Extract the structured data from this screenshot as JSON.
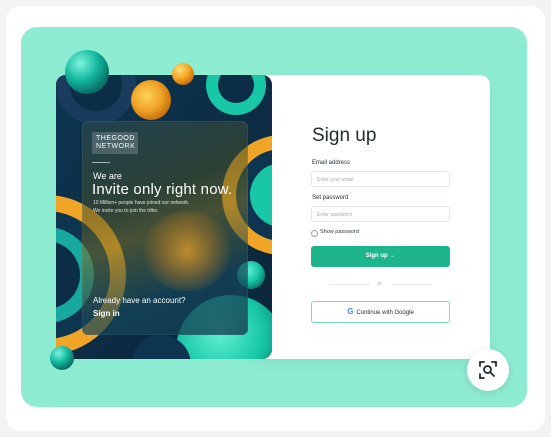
{
  "brand": {
    "line1": "THEGOOD",
    "line2": "NETWORK"
  },
  "promo": {
    "kicker": "We are",
    "headline": "Invite only right now.",
    "line1": "10 Million+ people have joined our network.",
    "line2": "We invite you to join the tribe.",
    "account_prompt": "Already have an account?",
    "signin_link": "Sign in"
  },
  "form": {
    "title": "Sign up",
    "email_label": "Email address",
    "email_placeholder": "Enter your email",
    "password_label": "Set password",
    "password_placeholder": "Enter password",
    "show_password_label": "Show password",
    "signup_button": "Sign up →",
    "or_text": "or",
    "google_button": "Continue with Google",
    "google_glyph": "G"
  },
  "icons": [
    "search-zoom-icon",
    "google-icon"
  ],
  "colors": {
    "mint_background": "#8eecd3",
    "primary_button": "#1fb58c",
    "dark_navy": "#0b2d45",
    "orange_accent": "#f0a526",
    "teal_accent": "#17c7a6"
  }
}
